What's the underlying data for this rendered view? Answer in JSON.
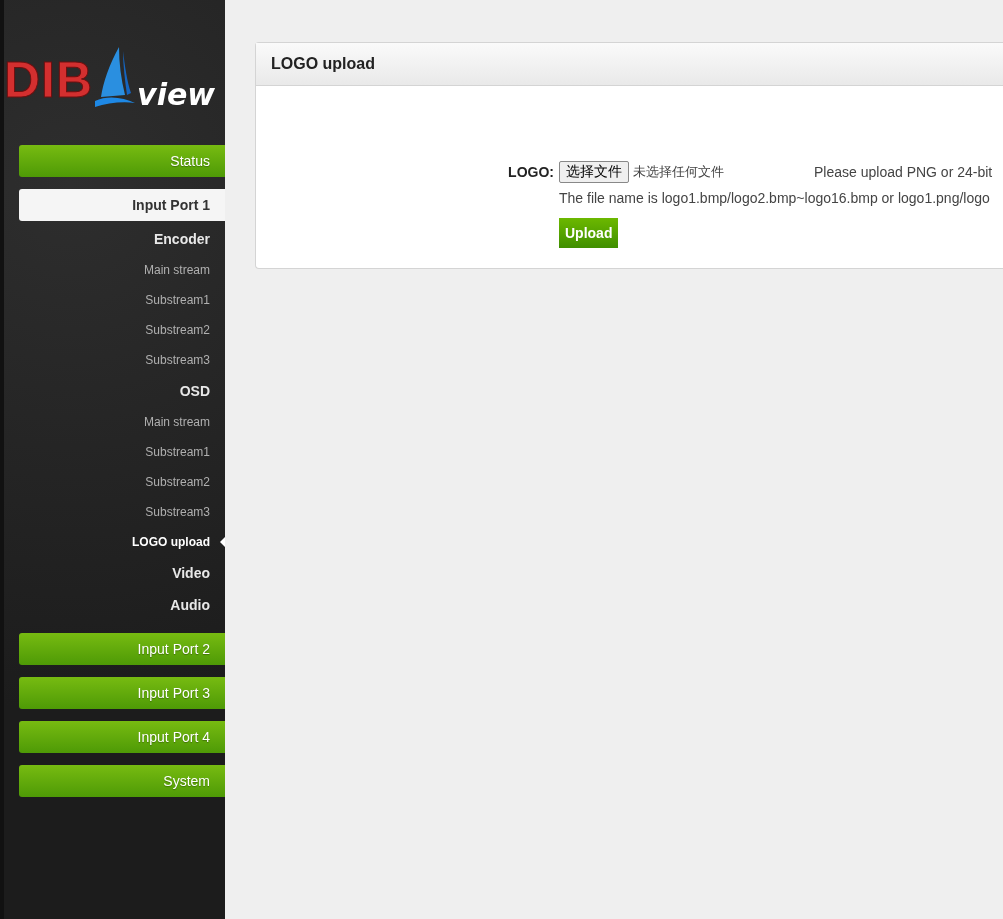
{
  "logo": {
    "brand": "DIB",
    "suffix": "view"
  },
  "nav": [
    {
      "label": "Status",
      "selected": false
    },
    {
      "label": "Input Port 1",
      "selected": true,
      "children": [
        {
          "label": "Encoder",
          "selected": false,
          "children": [
            {
              "label": "Main stream",
              "selected": false
            },
            {
              "label": "Substream1",
              "selected": false
            },
            {
              "label": "Substream2",
              "selected": false
            },
            {
              "label": "Substream3",
              "selected": false
            }
          ]
        },
        {
          "label": "OSD",
          "selected": false,
          "children": [
            {
              "label": "Main stream",
              "selected": false
            },
            {
              "label": "Substream1",
              "selected": false
            },
            {
              "label": "Substream2",
              "selected": false
            },
            {
              "label": "Substream3",
              "selected": false
            },
            {
              "label": "LOGO upload",
              "selected": true
            }
          ]
        },
        {
          "label": "Video",
          "selected": false
        },
        {
          "label": "Audio",
          "selected": false
        }
      ]
    },
    {
      "label": "Input Port 2",
      "selected": false
    },
    {
      "label": "Input Port 3",
      "selected": false
    },
    {
      "label": "Input Port 4",
      "selected": false
    },
    {
      "label": "System",
      "selected": false
    }
  ],
  "panel": {
    "title": "LOGO upload",
    "label": "LOGO:",
    "file_button": "选择文件",
    "file_status": "未选择任何文件",
    "hint": "Please upload PNG or 24-bit",
    "note": "The file name is logo1.bmp/logo2.bmp~logo16.bmp or logo1.png/logo",
    "submit": "Upload"
  }
}
